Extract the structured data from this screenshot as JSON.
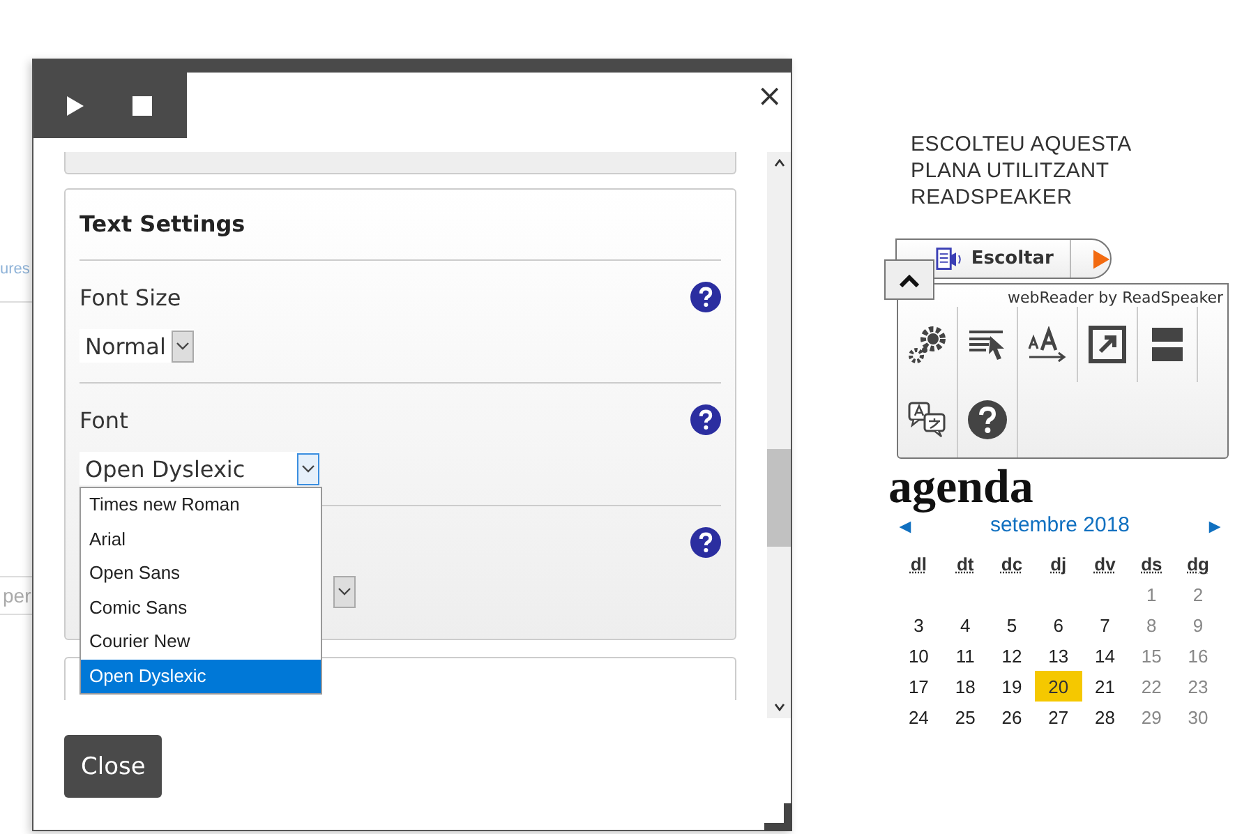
{
  "background": {
    "fragments": [
      {
        "text": "ures",
        "kind": "link"
      },
      {
        "text": "per",
        "kind": "placeholder"
      }
    ]
  },
  "dialog": {
    "toolbar": [
      {
        "kind": "play"
      },
      {
        "kind": "stop"
      }
    ],
    "close_symbol": "×",
    "sections": [
      {
        "title": "Text Settings",
        "settings": [
          {
            "label": "Font Size",
            "value": "Normal",
            "open": false
          },
          {
            "label": "Font",
            "value": "Open Dyslexic",
            "open": true,
            "options": [
              {
                "label": "Times new Roman",
                "selected": false
              },
              {
                "label": "Arial",
                "selected": false
              },
              {
                "label": "Open Sans",
                "selected": false
              },
              {
                "label": "Comic Sans",
                "selected": false
              },
              {
                "label": "Courier New",
                "selected": false
              },
              {
                "label": "Open Dyslexic",
                "selected": true
              }
            ]
          },
          {
            "open": false
          }
        ]
      }
    ],
    "close_button": "Close"
  },
  "readspeaker": {
    "heading": "ESCOLTEU AQUESTA PLANA UTILITZANT READSPEAKER",
    "listen_button": "Escoltar",
    "credit": "webReader by ReadSpeaker",
    "tools": [
      {
        "kind": "settings"
      },
      {
        "kind": "read-selection"
      },
      {
        "kind": "text-size"
      },
      {
        "kind": "popup"
      },
      {
        "kind": "page-mask"
      },
      {
        "kind": "translate"
      },
      {
        "kind": "help"
      }
    ]
  },
  "agenda_title": "agenda",
  "calendar": {
    "prev": "◄",
    "month": "setembre 2018",
    "next": "►",
    "weekdays": [
      "dl",
      "dt",
      "dc",
      "dj",
      "dv",
      "ds",
      "dg"
    ],
    "weeks": [
      [
        {
          "day": "1",
          "weekend": true,
          "highlighted": false
        },
        {
          "day": "2",
          "weekend": true,
          "highlighted": false
        }
      ],
      [
        {
          "day": "3",
          "weekend": false,
          "highlighted": false
        },
        {
          "day": "4",
          "weekend": false,
          "highlighted": false
        },
        {
          "day": "5",
          "weekend": false,
          "highlighted": false
        },
        {
          "day": "6",
          "weekend": false,
          "highlighted": false
        },
        {
          "day": "7",
          "weekend": false,
          "highlighted": false
        },
        {
          "day": "8",
          "weekend": true,
          "highlighted": false
        },
        {
          "day": "9",
          "weekend": true,
          "highlighted": false
        }
      ],
      [
        {
          "day": "10",
          "weekend": false,
          "highlighted": false
        },
        {
          "day": "11",
          "weekend": false,
          "highlighted": false
        },
        {
          "day": "12",
          "weekend": false,
          "highlighted": false
        },
        {
          "day": "13",
          "weekend": false,
          "highlighted": false
        },
        {
          "day": "14",
          "weekend": false,
          "highlighted": false
        },
        {
          "day": "15",
          "weekend": true,
          "highlighted": false
        },
        {
          "day": "16",
          "weekend": true,
          "highlighted": false
        }
      ],
      [
        {
          "day": "17",
          "weekend": false,
          "highlighted": false
        },
        {
          "day": "18",
          "weekend": false,
          "highlighted": false
        },
        {
          "day": "19",
          "weekend": false,
          "highlighted": false
        },
        {
          "day": "20",
          "weekend": false,
          "highlighted": true
        },
        {
          "day": "21",
          "weekend": false,
          "highlighted": false
        },
        {
          "day": "22",
          "weekend": true,
          "highlighted": false
        },
        {
          "day": "23",
          "weekend": true,
          "highlighted": false
        }
      ],
      [
        {
          "day": "24",
          "weekend": false,
          "highlighted": false
        },
        {
          "day": "25",
          "weekend": false,
          "highlighted": false
        },
        {
          "day": "26",
          "weekend": false,
          "highlighted": false
        },
        {
          "day": "27",
          "weekend": false,
          "highlighted": false
        },
        {
          "day": "28",
          "weekend": false,
          "highlighted": false
        },
        {
          "day": "29",
          "weekend": true,
          "highlighted": false
        },
        {
          "day": "30",
          "weekend": true,
          "highlighted": false
        }
      ]
    ]
  }
}
